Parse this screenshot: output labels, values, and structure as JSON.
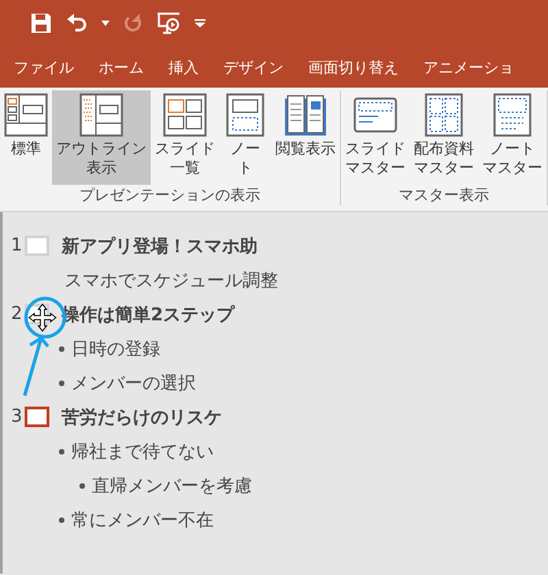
{
  "quick_access": [
    {
      "kind": "save",
      "disabled": false
    },
    {
      "kind": "undo",
      "disabled": false
    },
    {
      "kind": "caret",
      "disabled": false
    },
    {
      "kind": "redo",
      "disabled": true
    },
    {
      "kind": "present",
      "disabled": false
    },
    {
      "kind": "customize",
      "disabled": false
    }
  ],
  "tabs": [
    {
      "label": "ファイル",
      "selected": false
    },
    {
      "label": "ホーム",
      "selected": false
    },
    {
      "label": "挿入",
      "selected": false
    },
    {
      "label": "デザイン",
      "selected": false
    },
    {
      "label": "画面切り替え",
      "selected": false
    },
    {
      "label": "アニメーショ",
      "selected": false
    }
  ],
  "ribbon_groups": [
    {
      "label": "プレゼンテーションの表示",
      "buttons": [
        {
          "kind": "normal",
          "label_lines": [
            "標準"
          ],
          "selected": false
        },
        {
          "kind": "outline",
          "label_lines": [
            "アウトライン",
            "表示"
          ],
          "selected": true
        },
        {
          "kind": "sorter",
          "label_lines": [
            "スライド",
            "一覧"
          ],
          "selected": false
        },
        {
          "kind": "notes",
          "label_lines": [
            "ノー",
            "ト"
          ],
          "selected": false
        },
        {
          "kind": "reading",
          "label_lines": [
            "閲覧表示"
          ],
          "selected": false
        }
      ]
    },
    {
      "label": "マスター表示",
      "buttons": [
        {
          "kind": "slide_master",
          "label_lines": [
            "スライド",
            "マスター"
          ],
          "selected": false
        },
        {
          "kind": "handout_master",
          "label_lines": [
            "配布資料",
            "マスター"
          ],
          "selected": false
        },
        {
          "kind": "notes_master",
          "label_lines": [
            "ノート",
            "マスター"
          ],
          "selected": false
        }
      ]
    }
  ],
  "outline": [
    {
      "number": "1",
      "title": "新アプリ登場！スマホ助",
      "selected": false,
      "body": [
        {
          "kind": "text",
          "text": "スマホでスケジュール調整"
        }
      ]
    },
    {
      "number": "2",
      "title": "操作は簡単2ステップ",
      "selected": false,
      "body": [
        {
          "kind": "bullet",
          "text": "日時の登録"
        },
        {
          "kind": "bullet",
          "text": "メンバーの選択"
        }
      ]
    },
    {
      "number": "3",
      "title": "苦労だらけのリスケ",
      "selected": true,
      "body": [
        {
          "kind": "bullet",
          "text": "帰社まで待てない",
          "children": [
            {
              "kind": "bullet",
              "text": "直帰メンバーを考慮"
            }
          ]
        },
        {
          "kind": "bullet",
          "text": "常にメンバー不在"
        }
      ]
    }
  ]
}
